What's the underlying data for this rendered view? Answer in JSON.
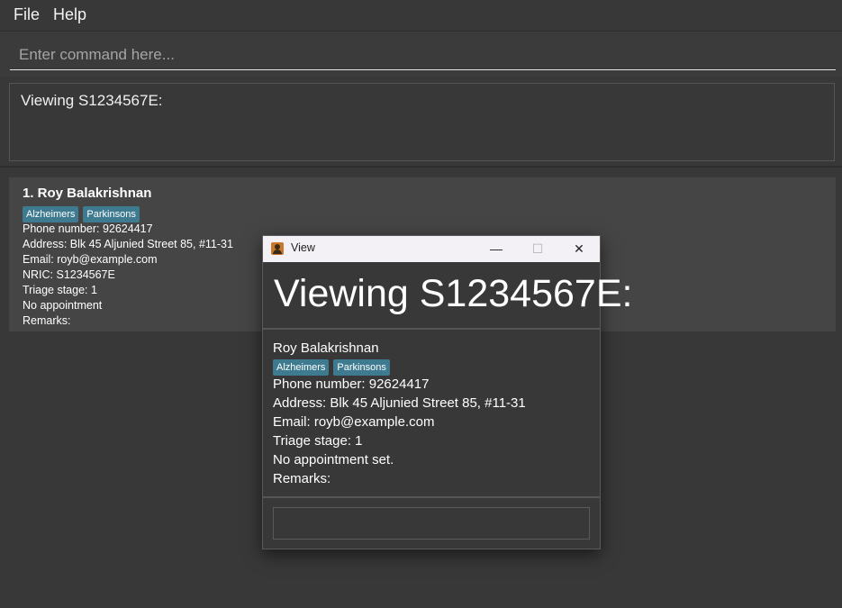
{
  "menu": {
    "file": "File",
    "help": "Help"
  },
  "command": {
    "placeholder": "Enter command here..."
  },
  "result": {
    "text": "Viewing S1234567E:"
  },
  "person": {
    "index_name": "1. Roy Balakrishnan",
    "tags": [
      "Alzheimers",
      "Parkinsons"
    ],
    "phone": "Phone number: 92624417",
    "address": "Address: Blk 45 Aljunied Street 85, #11-31",
    "email": "Email: royb@example.com",
    "nric": "NRIC: S1234567E",
    "triage": "Triage stage: 1",
    "appointment": "No appointment",
    "remarks": "Remarks:"
  },
  "dialog": {
    "title": "View",
    "heading": "Viewing S1234567E:",
    "name": "Roy Balakrishnan",
    "tags": [
      "Alzheimers",
      "Parkinsons"
    ],
    "phone": "Phone number: 92624417",
    "address": "Address: Blk 45 Aljunied Street 85, #11-31",
    "email": "Email: royb@example.com",
    "triage": "Triage stage: 1",
    "appointment": "No appointment set.",
    "remarks": "Remarks:",
    "controls": {
      "minimize": "—",
      "maximize": "☐",
      "close": "✕"
    }
  },
  "colors": {
    "background": "#383838",
    "card": "#454545",
    "tag": "#3e7b91",
    "titlebar": "#f3f1f6"
  }
}
